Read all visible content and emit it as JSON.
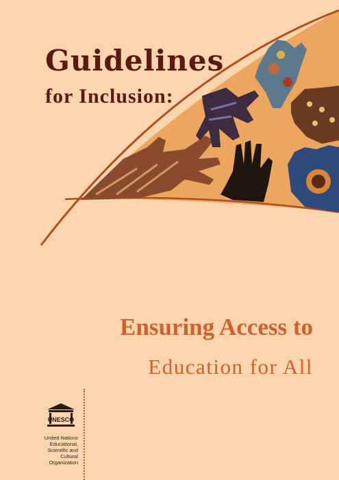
{
  "title": {
    "main": "Guidelines",
    "sub": "for Inclusion:"
  },
  "heading": {
    "line1": "Ensuring Access to",
    "line2": "Education for All"
  },
  "organization": {
    "logo_text": "UNESCO",
    "lines": [
      "United Nations",
      "Educational,",
      "Scientific and",
      "Cultural Organization"
    ]
  },
  "colors": {
    "background": "#fad5ae",
    "band": "#eda65f",
    "curve": "#b24d1d",
    "title": "#5a1a10",
    "heading": "#d0612e"
  }
}
